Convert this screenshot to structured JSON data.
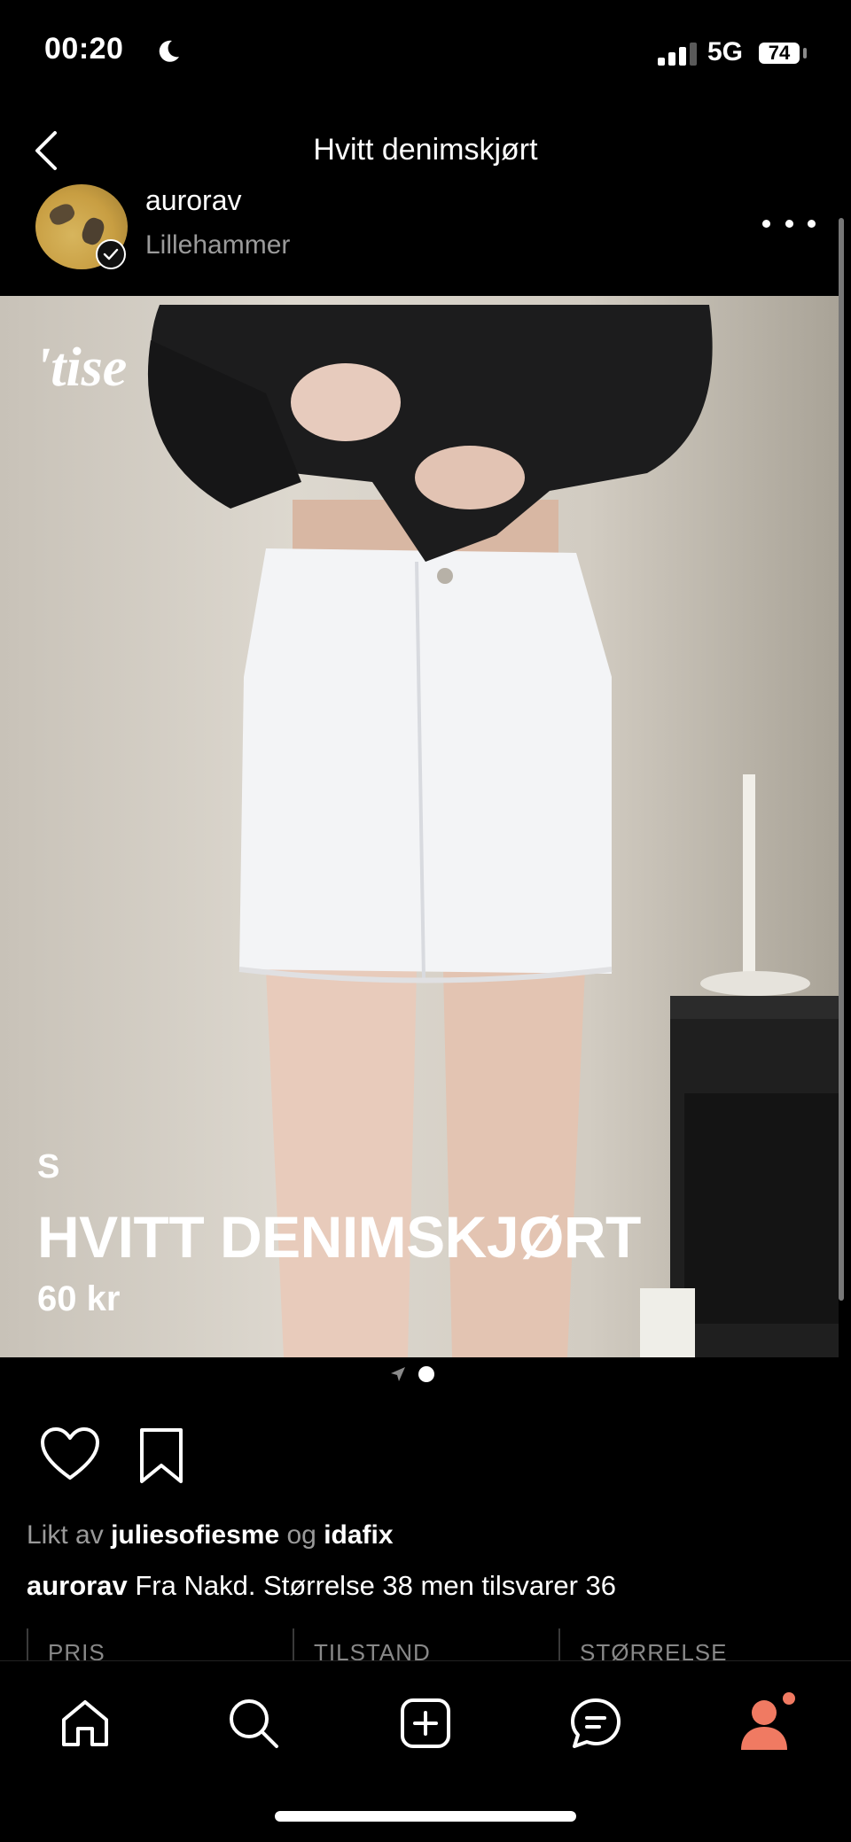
{
  "status_bar": {
    "time": "00:20",
    "network": "5G",
    "battery": "74"
  },
  "nav": {
    "title": "Hvitt denimskjørt"
  },
  "seller": {
    "username": "aurorav",
    "location": "Lillehammer"
  },
  "listing": {
    "brand_watermark": "'tise",
    "size": "S",
    "title": "HVITT DENIMSKJØRT",
    "price": "60 kr",
    "image_index": 2,
    "image_count": 2
  },
  "social": {
    "liked_prefix": "Likt av",
    "liked_user_1": "juliesofiesme",
    "liked_join": "og",
    "liked_user_2": "idafix",
    "caption_user": "aurorav",
    "caption_text": "Fra Nakd. Størrelse 38 men tilsvarer 36"
  },
  "info_table": {
    "columns": [
      "PRIS",
      "TILSTAND",
      "STØRRELSE"
    ]
  },
  "tab_bar": {
    "items": [
      {
        "icon": "home-icon"
      },
      {
        "icon": "search-icon"
      },
      {
        "icon": "add-listing-icon"
      },
      {
        "icon": "messages-icon"
      },
      {
        "icon": "profile-icon",
        "has_notification": true
      }
    ],
    "active_color": "#f07a62"
  }
}
